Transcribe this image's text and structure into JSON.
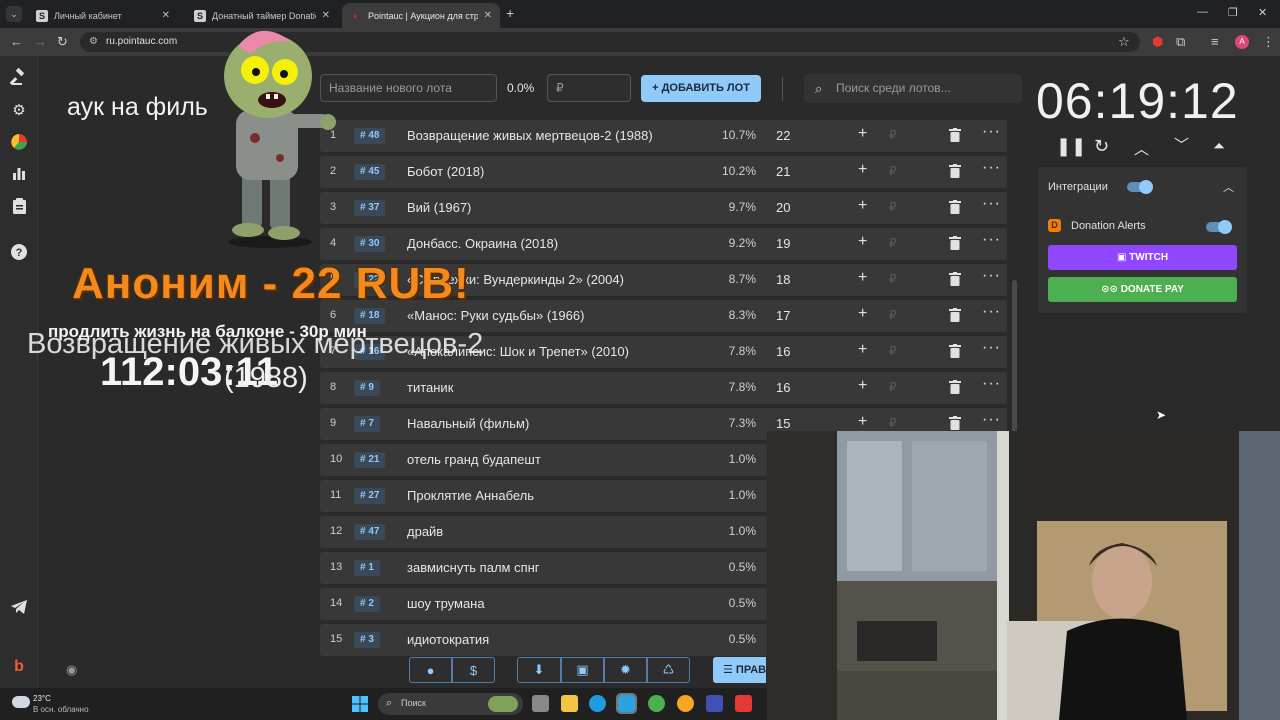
{
  "browser": {
    "tabs": [
      {
        "title": "Личный кабинет",
        "favicon": "S",
        "active": false
      },
      {
        "title": "Донатный таймер Donational",
        "favicon": "S",
        "active": false
      },
      {
        "title": "Pointauc | Аукцион для стрима",
        "favicon": "◐",
        "active": true
      }
    ],
    "url": "ru.pointauc.com",
    "profile_initial": "A"
  },
  "toolbar": {
    "new_lot_placeholder": "Название нового лота",
    "percent": "0.0%",
    "amount_placeholder": "₽",
    "add_lot_label": "ДОБАВИТЬ ЛОТ",
    "search_placeholder": "Поиск среди лотов..."
  },
  "lots": [
    {
      "n": "1",
      "id": "# 48",
      "name": "Возвращение живых мертвецов-2 (1988)",
      "pct": "10.7%",
      "amount": "22"
    },
    {
      "n": "2",
      "id": "# 45",
      "name": "Бобот (2018)",
      "pct": "10.2%",
      "amount": "21"
    },
    {
      "n": "3",
      "id": "# 37",
      "name": "Вий (1967)",
      "pct": "9.7%",
      "amount": "20"
    },
    {
      "n": "4",
      "id": "# 30",
      "name": "Донбасс. Окраина (2018)",
      "pct": "9.2%",
      "amount": "19"
    },
    {
      "n": "5",
      "id": "# 22",
      "name": "«Сыроежки: Вундеркинды 2» (2004)",
      "pct": "8.7%",
      "amount": "18"
    },
    {
      "n": "6",
      "id": "# 18",
      "name": "«Манос: Руки судьбы» (1966)",
      "pct": "8.3%",
      "amount": "17"
    },
    {
      "n": "7",
      "id": "# 16",
      "name": "«Апокалипсис: Шок и Трепет» (2010)",
      "pct": "7.8%",
      "amount": "16"
    },
    {
      "n": "8",
      "id": "# 9",
      "name": "титаник",
      "pct": "7.8%",
      "amount": "16"
    },
    {
      "n": "9",
      "id": "# 7",
      "name": "Навальный (фильм)",
      "pct": "7.3%",
      "amount": "15"
    },
    {
      "n": "10",
      "id": "# 21",
      "name": "отель гранд будапешт",
      "pct": "1.0%",
      "amount": ""
    },
    {
      "n": "11",
      "id": "# 27",
      "name": "Проклятие Аннабель",
      "pct": "1.0%",
      "amount": ""
    },
    {
      "n": "12",
      "id": "# 47",
      "name": "драйв",
      "pct": "1.0%",
      "amount": ""
    },
    {
      "n": "13",
      "id": "# 1",
      "name": "завмиснуть палм спнг",
      "pct": "0.5%",
      "amount": ""
    },
    {
      "n": "14",
      "id": "# 2",
      "name": "шоу трумана",
      "pct": "0.5%",
      "amount": ""
    },
    {
      "n": "15",
      "id": "# 3",
      "name": "идиотократия",
      "pct": "0.5%",
      "amount": ""
    }
  ],
  "row_actions": {
    "plus": "+",
    "currency": "₽",
    "more": "···"
  },
  "timer": "06:19:12",
  "integrations": {
    "title": "Интеграции",
    "donation_alerts": "Donation Alerts",
    "twitch": "TWITCH",
    "donatepay": "DONATE PAY"
  },
  "bottom_bar": {
    "rules_label": "ПРАВ"
  },
  "overlay": {
    "auction_title": "аук на филь",
    "donor": "Аноним - 22 RUB!",
    "donation_message": "продлить жизнь на балконе - 30р мин",
    "current_lot_name": "Возвращение живых мертвецов-2",
    "current_lot_year": "(1988)",
    "current_lot_timer": "112:03:11"
  },
  "taskbar": {
    "temperature": "23°C",
    "weather": "В осн. облачно",
    "search_placeholder": "Поиск"
  },
  "colors": {
    "accent": "#90caf9",
    "twitch": "#9147ff",
    "donatepay": "#4caf50",
    "donor_text": "#f28a1e"
  }
}
